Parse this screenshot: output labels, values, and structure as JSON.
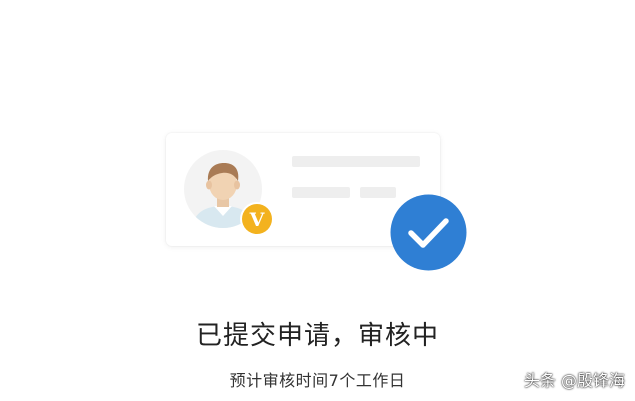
{
  "status": {
    "title": "已提交申请，审核中",
    "subtitle": "预计审核时间7个工作日"
  },
  "watermark": {
    "text": "头条 @殷锋海"
  },
  "icons": {
    "avatar": "user-avatar-icon",
    "verified": "verified-v-badge-icon",
    "check": "check-circle-icon"
  },
  "colors": {
    "check_blue": "#2f7fd4",
    "badge_gold": "#f3b21e",
    "placeholder_gray": "#eeeeee",
    "title_text": "#222222"
  }
}
